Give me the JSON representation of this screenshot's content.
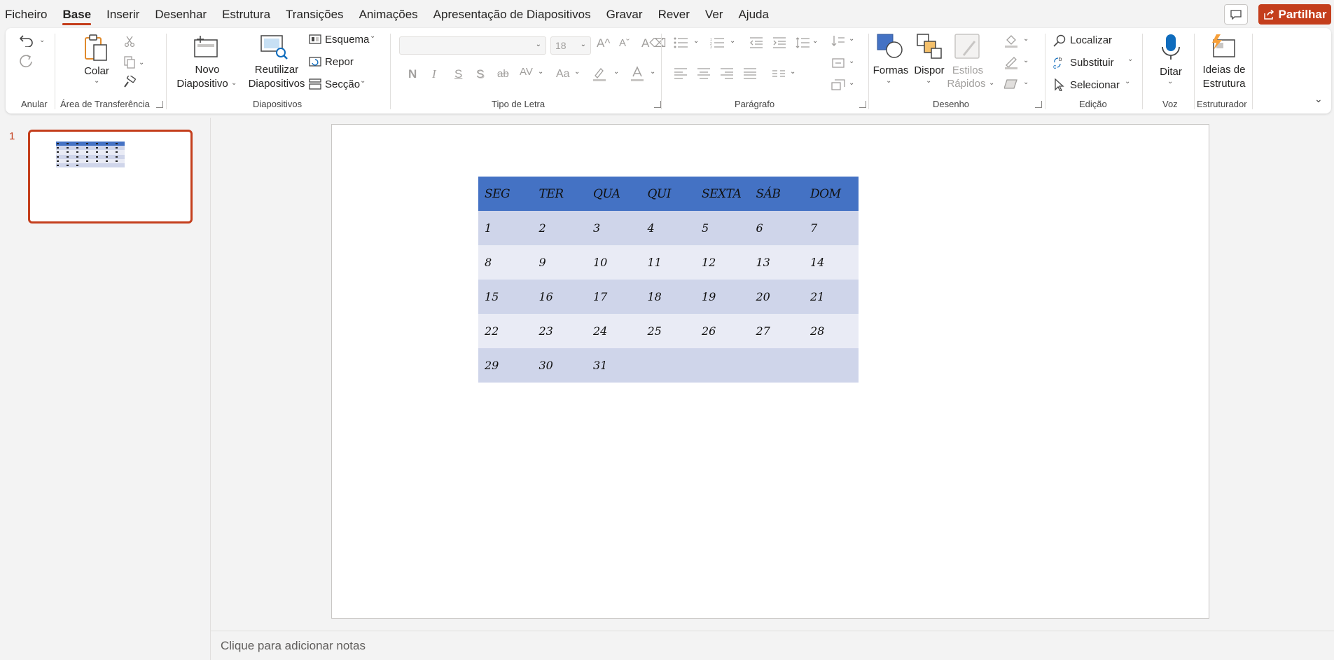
{
  "menu": {
    "tabs": [
      "Ficheiro",
      "Base",
      "Inserir",
      "Desenhar",
      "Estrutura",
      "Transições",
      "Animações",
      "Apresentação de Diapositivos",
      "Gravar",
      "Rever",
      "Ver",
      "Ajuda"
    ],
    "active_tab": "Base",
    "share_label": "Partilhar"
  },
  "ribbon": {
    "groups": {
      "anular": "Anular",
      "clipboard": "Área de Transferência",
      "slides": "Diapositivos",
      "font": "Tipo de Letra",
      "paragraph": "Parágrafo",
      "drawing": "Desenho",
      "editing": "Edição",
      "voice": "Voz",
      "designer": "Estruturador"
    },
    "colar": "Colar",
    "novo1": "Novo",
    "novo2": "Diapositivo",
    "reut1": "Reutilizar",
    "reut2": "Diapositivos",
    "esquema": "Esquema",
    "repor": "Repor",
    "seccao": "Secção",
    "font_size": "18",
    "bold": "N",
    "italic": "I",
    "underline": "S",
    "shadow": "S",
    "strike": "ab",
    "case": "Aa",
    "formas": "Formas",
    "dispor": "Dispor",
    "estilos1": "Estilos",
    "estilos2": "Rápidos",
    "localizar": "Localizar",
    "substituir": "Substituir",
    "selecionar": "Selecionar",
    "ditar": "Ditar",
    "ideias1": "Ideias de",
    "ideias2": "Estrutura"
  },
  "thumbnail": {
    "slide_number": "1"
  },
  "calendar": {
    "header": [
      "SEG",
      "TER",
      "QUA",
      "QUI",
      "SEXTA",
      "SÁB",
      "DOM"
    ],
    "rows": [
      [
        "1",
        "2",
        "3",
        "4",
        "5",
        "6",
        "7"
      ],
      [
        "8",
        "9",
        "10",
        "11",
        "12",
        "13",
        "14"
      ],
      [
        "15",
        "16",
        "17",
        "18",
        "19",
        "20",
        "21"
      ],
      [
        "22",
        "23",
        "24",
        "25",
        "26",
        "27",
        "28"
      ],
      [
        "29",
        "30",
        "31",
        "",
        "",
        "",
        ""
      ]
    ]
  },
  "notes": {
    "placeholder": "Clique para adicionar notas"
  },
  "colors": {
    "accent": "#c43e1c",
    "table_header": "#4472c4",
    "table_dark": "#cfd5ea",
    "table_light": "#e9ebf5"
  }
}
